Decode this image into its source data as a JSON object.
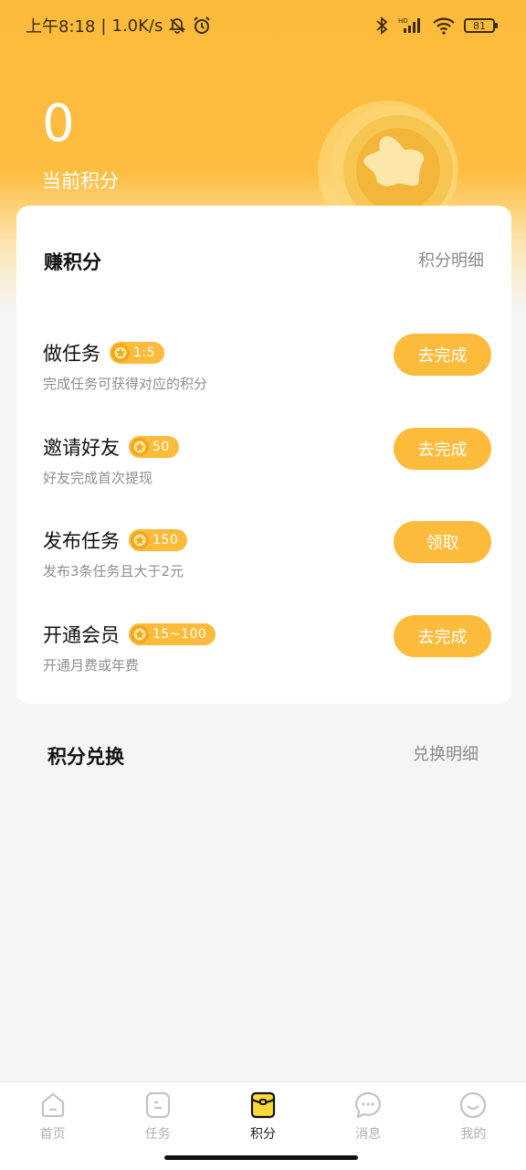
{
  "status_bar": {
    "time": "上午8:18",
    "separator": "|",
    "speed": "1.0K/s",
    "battery": "81",
    "icons": [
      "mute-icon",
      "alarm-icon",
      "bluetooth-icon",
      "hd-signal-icon",
      "wifi-icon",
      "battery-icon"
    ]
  },
  "points": {
    "value": "0",
    "label": "当前积分"
  },
  "earn": {
    "title": "赚积分",
    "detail_link": "积分明细",
    "tasks": [
      {
        "name": "做任务",
        "badge": "1:5",
        "desc": "完成任务可获得对应的积分",
        "button": "去完成"
      },
      {
        "name": "邀请好友",
        "badge": "50",
        "desc": "好友完成首次提现",
        "button": "去完成"
      },
      {
        "name": "发布任务",
        "badge": "150",
        "desc": "发布3条任务且大于2元",
        "button": "领取"
      },
      {
        "name": "开通会员",
        "badge": "15~100",
        "desc": "开通月费或年费",
        "button": "去完成"
      }
    ]
  },
  "exchange": {
    "title": "积分兑换",
    "detail_link": "兑换明细"
  },
  "tab_bar": {
    "active": "积分",
    "tabs": [
      {
        "label": "首页",
        "icon": "home-icon"
      },
      {
        "label": "任务",
        "icon": "task-icon"
      },
      {
        "label": "积分",
        "icon": "points-wallet-icon"
      },
      {
        "label": "消息",
        "icon": "message-icon"
      },
      {
        "label": "我的",
        "icon": "profile-icon"
      }
    ]
  },
  "colors": {
    "accent": "#fdbb3b",
    "background": "#f5f5f5",
    "text_primary": "#111111",
    "text_secondary": "#8f8f8f"
  }
}
